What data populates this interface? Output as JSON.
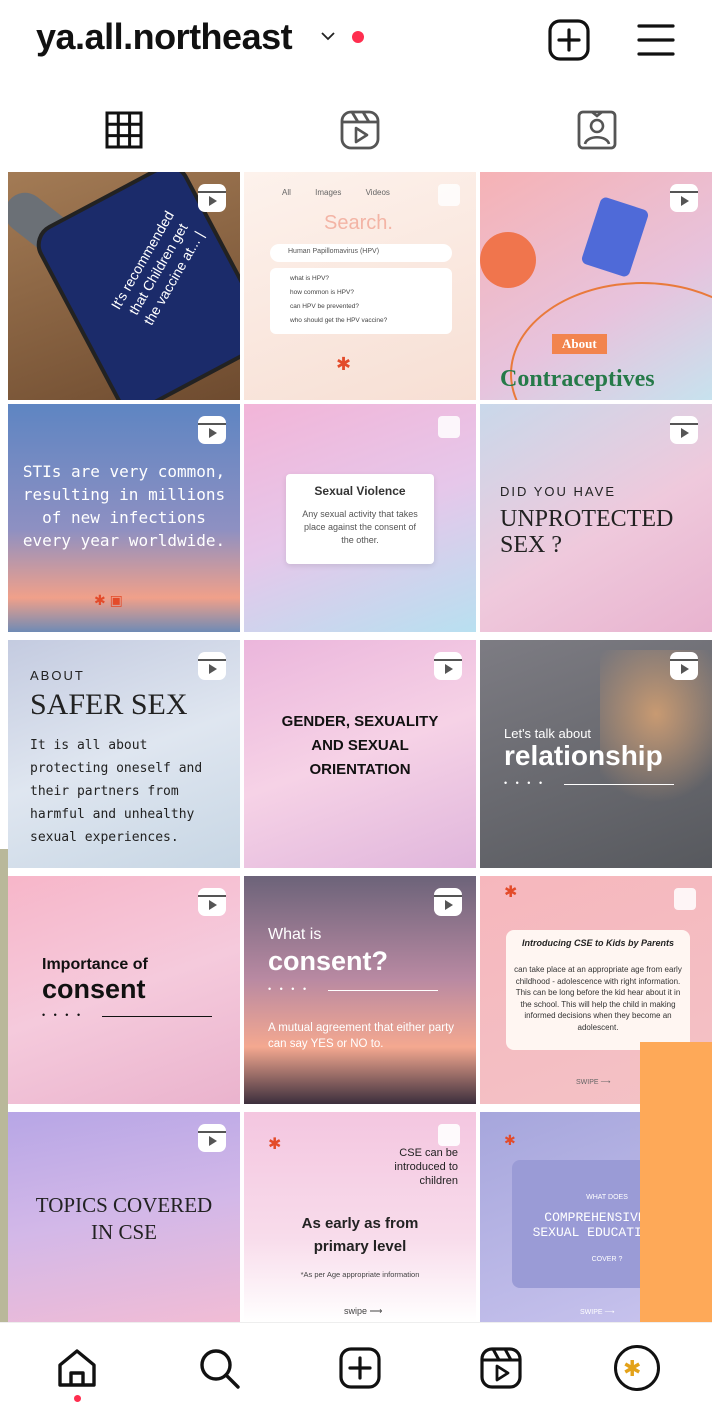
{
  "header": {
    "username": "ya.all.northeast"
  },
  "tiles": {
    "t1": {
      "text": "It's recommended that Children get the vaccine at... |"
    },
    "t2": {
      "tabs": [
        "All",
        "Images",
        "Videos"
      ],
      "search": "Search.",
      "query": "Human Papillomavirus (HPV)",
      "suggestions": [
        "what is HPV?",
        "how common is HPV?",
        "can HPV be prevented?",
        "who should get the HPV vaccine?"
      ]
    },
    "t3": {
      "kicker": "About",
      "title": "Contraceptives"
    },
    "t4": {
      "text": "STIs are very common, resulting in millions of new infections every year worldwide."
    },
    "t5": {
      "title": "Sexual Violence",
      "body": "Any sexual activity that takes place against the consent of the other."
    },
    "t6": {
      "kicker": "DID YOU HAVE",
      "title": "UNPROTECTED SEX ?"
    },
    "t7": {
      "kicker": "ABOUT",
      "title": "SAFER SEX",
      "body": "It is all about protecting oneself and their partners from harmful and unhealthy sexual experiences."
    },
    "t8": {
      "text": "GENDER, SEXUALITY AND SEXUAL ORIENTATION"
    },
    "t9": {
      "kicker": "Let's talk about",
      "title": "relationship",
      "dots": "• • • •"
    },
    "t10": {
      "kicker": "Importance of",
      "title": "consent",
      "dots": "• • • •"
    },
    "t11": {
      "kicker": "What is",
      "title": "consent?",
      "dots": "• • • •",
      "body": "A mutual agreement that either party can say YES or NO to."
    },
    "t12": {
      "title": "Introducing CSE to Kids by Parents",
      "body": "can take place at an appropriate age from early childhood - adolescence with right information. This can be long before the kid hear about it in the school. This will help the child in making informed decisions when they become an adolescent.",
      "swipe": "SWIPE ⟶"
    },
    "t13": {
      "text": "TOPICS COVERED IN CSE"
    },
    "t14": {
      "top": "CSE can be introduced to children",
      "title": "As early as from primary level",
      "note": "*As per Age appropriate information",
      "swipe": "swipe ⟶"
    },
    "t15": {
      "kicker": "WHAT DOES",
      "title": "COMPREHENSIVE SEXUAL EDUCATION",
      "sub": "COVER ?",
      "swipe": "SWIPE ⟶"
    }
  },
  "colors": {
    "accent_red": "#ff2e4f",
    "overlay_orange": "#fea958",
    "left_strip_yellow": "#eaff3a"
  },
  "icons": {
    "header": [
      "chevron-down-icon",
      "new-post-icon",
      "menu-icon"
    ],
    "tabs": [
      "grid-icon",
      "reels-icon",
      "tagged-icon"
    ],
    "bottom_nav": [
      "home-icon",
      "search-icon",
      "create-icon",
      "reels-icon",
      "profile-avatar"
    ]
  }
}
